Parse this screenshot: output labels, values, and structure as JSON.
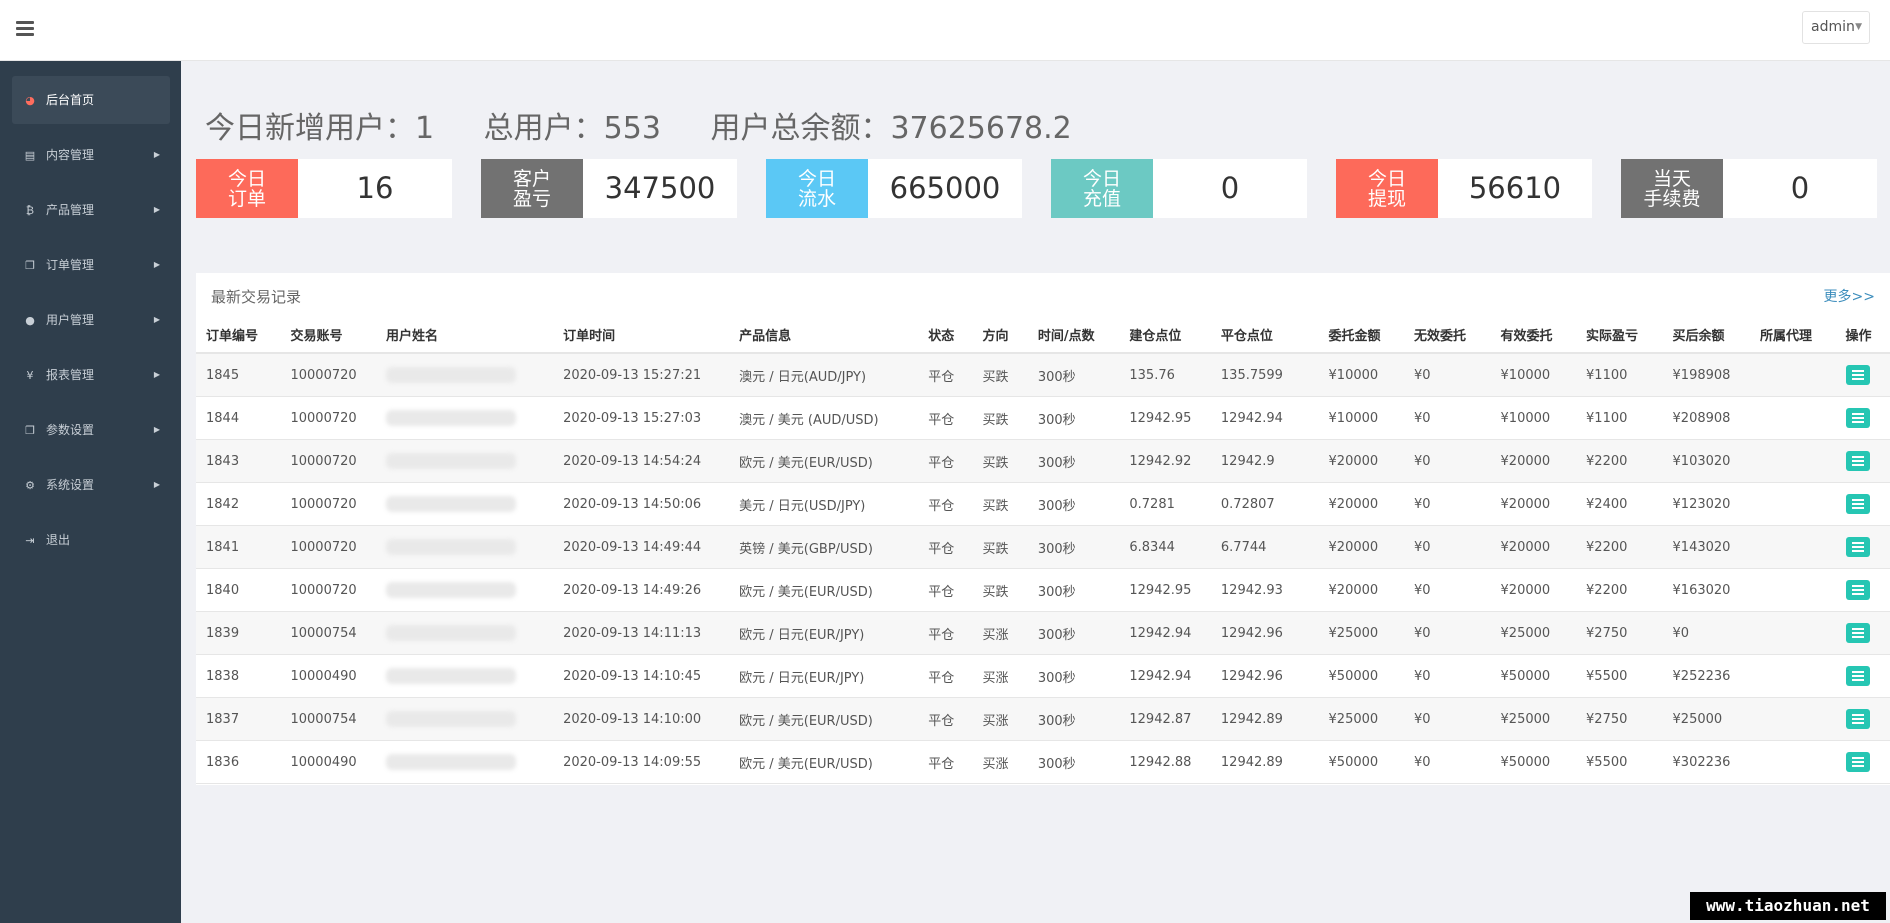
{
  "topbar": {
    "user": "admin"
  },
  "sidebar": {
    "items": [
      {
        "label": "后台首页",
        "icon": "dashboard-icon",
        "glyph": "◕",
        "active": true
      },
      {
        "label": "内容管理",
        "icon": "book-icon",
        "glyph": "▤"
      },
      {
        "label": "产品管理",
        "icon": "bitcoin-icon",
        "glyph": "₿"
      },
      {
        "label": "订单管理",
        "icon": "copy-icon",
        "glyph": "❐"
      },
      {
        "label": "用户管理",
        "icon": "user-icon",
        "glyph": "●"
      },
      {
        "label": "报表管理",
        "icon": "yen-icon",
        "glyph": "¥"
      },
      {
        "label": "参数设置",
        "icon": "copy-icon",
        "glyph": "❐"
      },
      {
        "label": "系统设置",
        "icon": "gears-icon",
        "glyph": "⚙"
      },
      {
        "label": "退出",
        "icon": "sign-out-icon",
        "glyph": "⇥"
      }
    ]
  },
  "summary": {
    "new_users": "今日新增用户：1",
    "total_users": "总用户：553",
    "total_balance": "用户总余额：37625678.2"
  },
  "stats": [
    {
      "label": "今日\n订单",
      "value": "16",
      "color": "#fd6a5a"
    },
    {
      "label": "客户\n盈亏",
      "value": "347500",
      "color": "#727272"
    },
    {
      "label": "今日\n流水",
      "value": "665000",
      "color": "#5bc8f5"
    },
    {
      "label": "今日\n充值",
      "value": "0",
      "color": "#6cc9c3"
    },
    {
      "label": "今日\n提现",
      "value": "56610",
      "color": "#fd6a5a"
    },
    {
      "label": "当天\n手续费",
      "value": "0",
      "color": "#727272"
    }
  ],
  "panel": {
    "title": "最新交易记录",
    "more": "更多>>",
    "headers": [
      "订单编号",
      "交易账号",
      "用户姓名",
      "订单时间",
      "产品信息",
      "状态",
      "方向",
      "时间/点数",
      "建仓点位",
      "平仓点位",
      "委托金额",
      "无效委托",
      "有效委托",
      "实际盈亏",
      "买后余额",
      "所属代理",
      "操作"
    ],
    "rows": [
      {
        "id": "1845",
        "account": "10000720",
        "time": "2020-09-13 15:27:21",
        "product": "澳元 / 日元(AUD/JPY)",
        "status": "平仓",
        "dir": "买跌",
        "dur": "300秒",
        "open": "135.76",
        "close": "135.7599",
        "amount": "¥10000",
        "invalid": "¥0",
        "valid": "¥10000",
        "pnl": "¥1100",
        "balance": "¥198908",
        "agent": ""
      },
      {
        "id": "1844",
        "account": "10000720",
        "time": "2020-09-13 15:27:03",
        "product": "澳元 / 美元 (AUD/USD)",
        "status": "平仓",
        "dir": "买跌",
        "dur": "300秒",
        "open": "12942.95",
        "close": "12942.94",
        "amount": "¥10000",
        "invalid": "¥0",
        "valid": "¥10000",
        "pnl": "¥1100",
        "balance": "¥208908",
        "agent": ""
      },
      {
        "id": "1843",
        "account": "10000720",
        "time": "2020-09-13 14:54:24",
        "product": "欧元 / 美元(EUR/USD)",
        "status": "平仓",
        "dir": "买跌",
        "dur": "300秒",
        "open": "12942.92",
        "close": "12942.9",
        "amount": "¥20000",
        "invalid": "¥0",
        "valid": "¥20000",
        "pnl": "¥2200",
        "balance": "¥103020",
        "agent": ""
      },
      {
        "id": "1842",
        "account": "10000720",
        "time": "2020-09-13 14:50:06",
        "product": "美元 / 日元(USD/JPY)",
        "status": "平仓",
        "dir": "买跌",
        "dur": "300秒",
        "open": "0.7281",
        "close": "0.72807",
        "amount": "¥20000",
        "invalid": "¥0",
        "valid": "¥20000",
        "pnl": "¥2400",
        "balance": "¥123020",
        "agent": ""
      },
      {
        "id": "1841",
        "account": "10000720",
        "time": "2020-09-13 14:49:44",
        "product": "英镑 / 美元(GBP/USD)",
        "status": "平仓",
        "dir": "买跌",
        "dur": "300秒",
        "open": "6.8344",
        "close": "6.7744",
        "amount": "¥20000",
        "invalid": "¥0",
        "valid": "¥20000",
        "pnl": "¥2200",
        "balance": "¥143020",
        "agent": ""
      },
      {
        "id": "1840",
        "account": "10000720",
        "time": "2020-09-13 14:49:26",
        "product": "欧元 / 美元(EUR/USD)",
        "status": "平仓",
        "dir": "买跌",
        "dur": "300秒",
        "open": "12942.95",
        "close": "12942.93",
        "amount": "¥20000",
        "invalid": "¥0",
        "valid": "¥20000",
        "pnl": "¥2200",
        "balance": "¥163020",
        "agent": ""
      },
      {
        "id": "1839",
        "account": "10000754",
        "time": "2020-09-13 14:11:13",
        "product": "欧元 / 日元(EUR/JPY)",
        "status": "平仓",
        "dir": "买涨",
        "dur": "300秒",
        "open": "12942.94",
        "close": "12942.96",
        "amount": "¥25000",
        "invalid": "¥0",
        "valid": "¥25000",
        "pnl": "¥2750",
        "balance": "¥0",
        "agent": ""
      },
      {
        "id": "1838",
        "account": "10000490",
        "time": "2020-09-13 14:10:45",
        "product": "欧元 / 日元(EUR/JPY)",
        "status": "平仓",
        "dir": "买涨",
        "dur": "300秒",
        "open": "12942.94",
        "close": "12942.96",
        "amount": "¥50000",
        "invalid": "¥0",
        "valid": "¥50000",
        "pnl": "¥5500",
        "balance": "¥252236",
        "agent": ""
      },
      {
        "id": "1837",
        "account": "10000754",
        "time": "2020-09-13 14:10:00",
        "product": "欧元 / 美元(EUR/USD)",
        "status": "平仓",
        "dir": "买涨",
        "dur": "300秒",
        "open": "12942.87",
        "close": "12942.89",
        "amount": "¥25000",
        "invalid": "¥0",
        "valid": "¥25000",
        "pnl": "¥2750",
        "balance": "¥25000",
        "agent": ""
      },
      {
        "id": "1836",
        "account": "10000490",
        "time": "2020-09-13 14:09:55",
        "product": "欧元 / 美元(EUR/USD)",
        "status": "平仓",
        "dir": "买涨",
        "dur": "300秒",
        "open": "12942.88",
        "close": "12942.89",
        "amount": "¥50000",
        "invalid": "¥0",
        "valid": "¥50000",
        "pnl": "¥5500",
        "balance": "¥302236",
        "agent": ""
      }
    ]
  },
  "watermark": "www.tiaozhuan.net"
}
